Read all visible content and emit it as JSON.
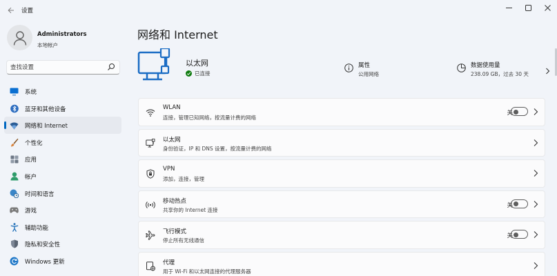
{
  "window": {
    "title": "设置"
  },
  "user": {
    "name": "Administrators",
    "account_type": "本地帐户"
  },
  "search": {
    "placeholder": "查找设置"
  },
  "nav": {
    "items": [
      {
        "label": "系统",
        "icon": "monitor-icon"
      },
      {
        "label": "蓝牙和其他设备",
        "icon": "bluetooth-icon"
      },
      {
        "label": "网络和 Internet",
        "icon": "wifi-icon",
        "active": true
      },
      {
        "label": "个性化",
        "icon": "brush-icon"
      },
      {
        "label": "应用",
        "icon": "apps-icon"
      },
      {
        "label": "帐户",
        "icon": "person-icon"
      },
      {
        "label": "时间和语言",
        "icon": "globe-clock-icon"
      },
      {
        "label": "游戏",
        "icon": "gamepad-icon"
      },
      {
        "label": "辅助功能",
        "icon": "accessibility-icon"
      },
      {
        "label": "隐私和安全性",
        "icon": "shield-icon"
      },
      {
        "label": "Windows 更新",
        "icon": "update-icon"
      }
    ]
  },
  "page": {
    "title": "网络和 Internet"
  },
  "hero": {
    "name": "以太网",
    "status": "已连接",
    "properties": {
      "title": "属性",
      "value": "公用网络"
    },
    "data_usage": {
      "title": "数据使用量",
      "value": "238.09 GB，过去 30 天"
    }
  },
  "cards": [
    {
      "title": "WLAN",
      "desc": "连接，管理已知网络，按流量计费的网络",
      "icon": "wifi-icon",
      "toggle": "关"
    },
    {
      "title": "以太网",
      "desc": "身份验证，IP 和 DNS 设置，按流量计费的网络",
      "icon": "ethernet-icon"
    },
    {
      "title": "VPN",
      "desc": "添加，连接，管理",
      "icon": "vpn-shield-icon"
    },
    {
      "title": "移动热点",
      "desc": "共享你的 Internet 连接",
      "icon": "hotspot-icon",
      "toggle": "关"
    },
    {
      "title": "飞行模式",
      "desc": "停止所有无线通信",
      "icon": "airplane-icon",
      "toggle": "关"
    },
    {
      "title": "代理",
      "desc": "用于 Wi-Fi 和以太网连接的代理服务器",
      "icon": "globe-icon"
    }
  ],
  "colors": {
    "accent": "#0067c0",
    "connected": "#0f7b0f",
    "background": "#f1f4f9",
    "card": "#fbfbfc"
  }
}
